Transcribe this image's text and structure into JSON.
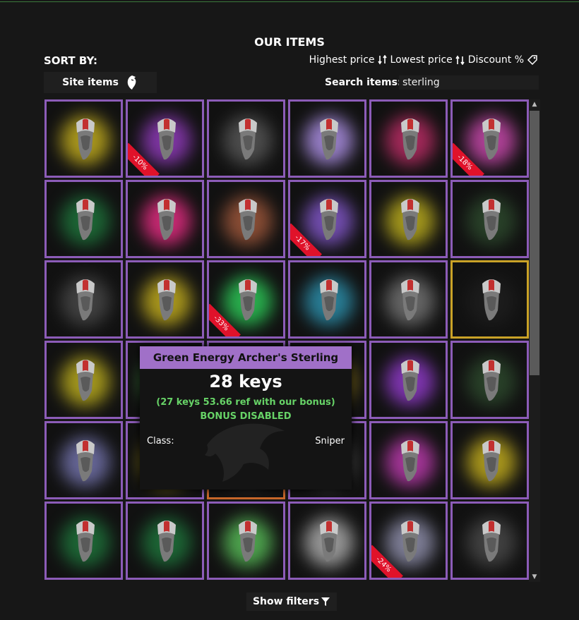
{
  "page": {
    "title": "OUR ITEMS",
    "sort_by_label": "SORT BY:",
    "sort_options": [
      "Highest price",
      "Lowest price",
      "Discount %"
    ],
    "site_items_label": "Site items",
    "search_label": "Search items:",
    "search_value": "sterling",
    "show_filters_label": "Show filters"
  },
  "grid": {
    "items": [
      {
        "glow": "#d8c020",
        "discount": "",
        "border": "purple"
      },
      {
        "glow": "#a040d0",
        "discount": "-10%",
        "border": "purple"
      },
      {
        "glow": "#606060",
        "discount": "",
        "border": "purple"
      },
      {
        "glow": "#c0a0ff",
        "discount": "",
        "border": "purple"
      },
      {
        "glow": "#d03070",
        "discount": "",
        "border": "purple"
      },
      {
        "glow": "#e050c0",
        "discount": "-18%",
        "border": "purple"
      },
      {
        "glow": "#208040",
        "discount": "",
        "border": "purple"
      },
      {
        "glow": "#ff3090",
        "discount": "",
        "border": "purple"
      },
      {
        "glow": "#b06040",
        "discount": "",
        "border": "purple"
      },
      {
        "glow": "#9060e0",
        "discount": "-17%",
        "border": "purple"
      },
      {
        "glow": "#d0c020",
        "discount": "",
        "border": "purple"
      },
      {
        "glow": "#305030",
        "discount": "",
        "border": "purple"
      },
      {
        "glow": "#505050",
        "discount": "",
        "border": "purple"
      },
      {
        "glow": "#d8c020",
        "discount": "",
        "border": "purple"
      },
      {
        "glow": "#30e060",
        "discount": "-33%",
        "border": "purple"
      },
      {
        "glow": "#30a0c0",
        "discount": "",
        "border": "purple"
      },
      {
        "glow": "#808080",
        "discount": "",
        "border": "purple"
      },
      {
        "glow": "#202020",
        "discount": "",
        "border": "gold"
      },
      {
        "glow": "#d0c020",
        "discount": "",
        "border": "purple"
      },
      {
        "glow": "#60d060",
        "discount": "",
        "border": "purple"
      },
      {
        "glow": "#404040",
        "discount": "",
        "border": "purple"
      },
      {
        "glow": "#c0a020",
        "discount": "",
        "border": "purple"
      },
      {
        "glow": "#a040e0",
        "discount": "",
        "border": "purple"
      },
      {
        "glow": "#305030",
        "discount": "",
        "border": "purple"
      },
      {
        "glow": "#8080c0",
        "discount": "",
        "border": "purple"
      },
      {
        "glow": "#d8c020",
        "discount": "",
        "border": "purple"
      },
      {
        "glow": "#404040",
        "discount": "",
        "border": "orange"
      },
      {
        "glow": "#606060",
        "discount": "",
        "border": "purple"
      },
      {
        "glow": "#d040c0",
        "discount": "",
        "border": "purple"
      },
      {
        "glow": "#d8c020",
        "discount": "",
        "border": "purple"
      },
      {
        "glow": "#208040",
        "discount": "",
        "border": "purple"
      },
      {
        "glow": "#208040",
        "discount": "",
        "border": "purple"
      },
      {
        "glow": "#60d060",
        "discount": "",
        "border": "purple"
      },
      {
        "glow": "#c0c0c0",
        "discount": "",
        "border": "purple"
      },
      {
        "glow": "#a0a0c0",
        "discount": "-24%",
        "border": "purple"
      },
      {
        "glow": "#505050",
        "discount": "",
        "border": "purple"
      }
    ]
  },
  "tooltip": {
    "name": "Green Energy Archer's Sterling",
    "price": "28 keys",
    "bonus_price": "(27 keys 53.66 ref with our bonus)",
    "bonus_status": "BONUS DISABLED",
    "class_label": "Class:",
    "class_value": "Sniper"
  }
}
